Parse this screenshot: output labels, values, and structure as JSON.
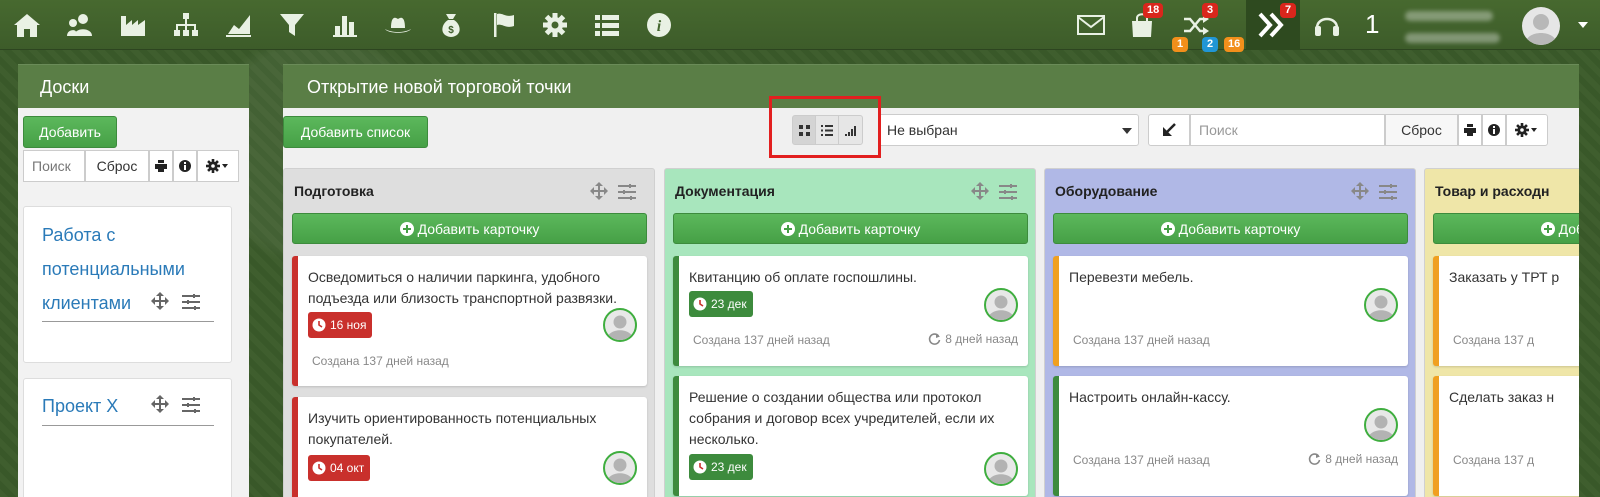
{
  "topbar": {
    "icons": [
      "home-icon",
      "users-icon",
      "factory-icon",
      "org-chart-icon",
      "area-chart-icon",
      "filter-icon",
      "bar-chart-icon",
      "hat-icon",
      "money-bag-icon",
      "flag-icon",
      "gear-icon",
      "list-icon",
      "info-icon"
    ],
    "badges": {
      "bag": "18",
      "shuffle_red": "3",
      "shuffle_orange": "1",
      "shuffle_blue": "2",
      "shuffle_orange2": "16",
      "forward": "7"
    },
    "notif_count": "1"
  },
  "sidebar": {
    "title": "Доски",
    "add_label": "Добавить",
    "search_label": "Поиск",
    "reset_label": "Сброс",
    "boards": [
      {
        "lines": [
          "Работа с",
          "потенциальными",
          "клиентами"
        ]
      },
      {
        "lines": [
          "Проект X"
        ]
      }
    ]
  },
  "main": {
    "title": "Открытие новой торговой точки",
    "add_list_label": "Добавить список",
    "select_value": "Не выбран",
    "search_placeholder": "Поиск",
    "reset_label": "Сброс",
    "add_card_label": "Добавить карточку",
    "columns": [
      {
        "title": "Подготовка",
        "color": "#dedede",
        "cards": [
          {
            "text": "Осведомиться о наличии паркинга, удобного подъезда или близость транспортной развязки.",
            "date": "16 ноя",
            "created": "Создана 137 дней назад",
            "stripe": "#c9302c"
          },
          {
            "text": "Изучить ориентированность потенциальных покупателей.",
            "date": "04 окт",
            "stripe": "#c9302c"
          }
        ]
      },
      {
        "title": "Документация",
        "color": "#a8e6bd",
        "cards": [
          {
            "text": "Квитанцию об оплате госпошлины.",
            "date": "23 дек",
            "created": "Создана 137 дней назад",
            "updated": "8 дней назад",
            "stripe": "#3d8b3d"
          },
          {
            "text": "Решение о создании общества или протокол собрания и договор всех учредителей, если их несколько.",
            "date": "23 дек",
            "stripe": "#3d8b3d"
          }
        ]
      },
      {
        "title": "Оборудование",
        "color": "#b0b8e6",
        "cards": [
          {
            "text": "Перевезти мебель.",
            "created": "Создана 137 дней назад",
            "stripe": "#f0a020"
          },
          {
            "text": "Настроить онлайн-кассу.",
            "created": "Создана 137 дней назад",
            "updated": "8 дней назад",
            "stripe": "#3d8b3d"
          }
        ]
      },
      {
        "title": "Товар и расходн",
        "color": "#efe6a8",
        "cards": [
          {
            "text": "Заказать у ТРТ р",
            "created": "Создана 137 д",
            "stripe": "#f0a020"
          },
          {
            "text": "Сделать заказ н",
            "created": "Создана 137 д",
            "stripe": "#f0a020"
          }
        ]
      }
    ]
  }
}
